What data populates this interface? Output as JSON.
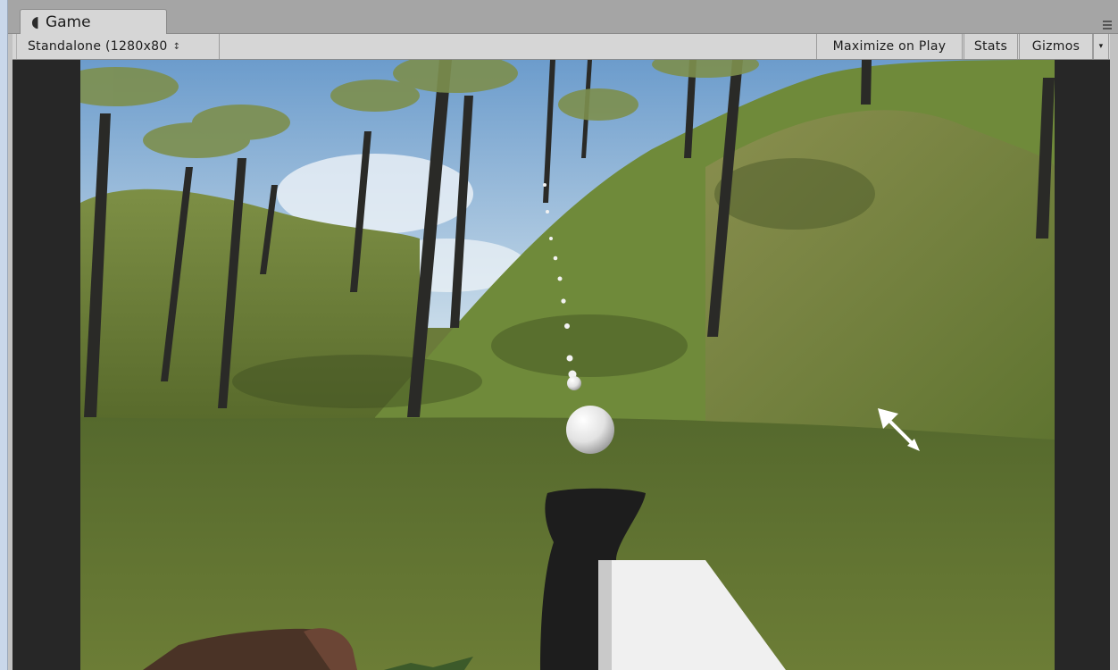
{
  "tab": {
    "title": "Game",
    "icon": "pacman-icon"
  },
  "toolbar": {
    "resolution_label": "Standalone (1280x80",
    "maximize_label": "Maximize on Play",
    "stats_label": "Stats",
    "gizmos_label": "Gizmos"
  },
  "colors": {
    "sky": "#8fb6dc",
    "grass": "#6a7f34",
    "trunk": "#2a2a28",
    "viewport_border": "#272727"
  }
}
